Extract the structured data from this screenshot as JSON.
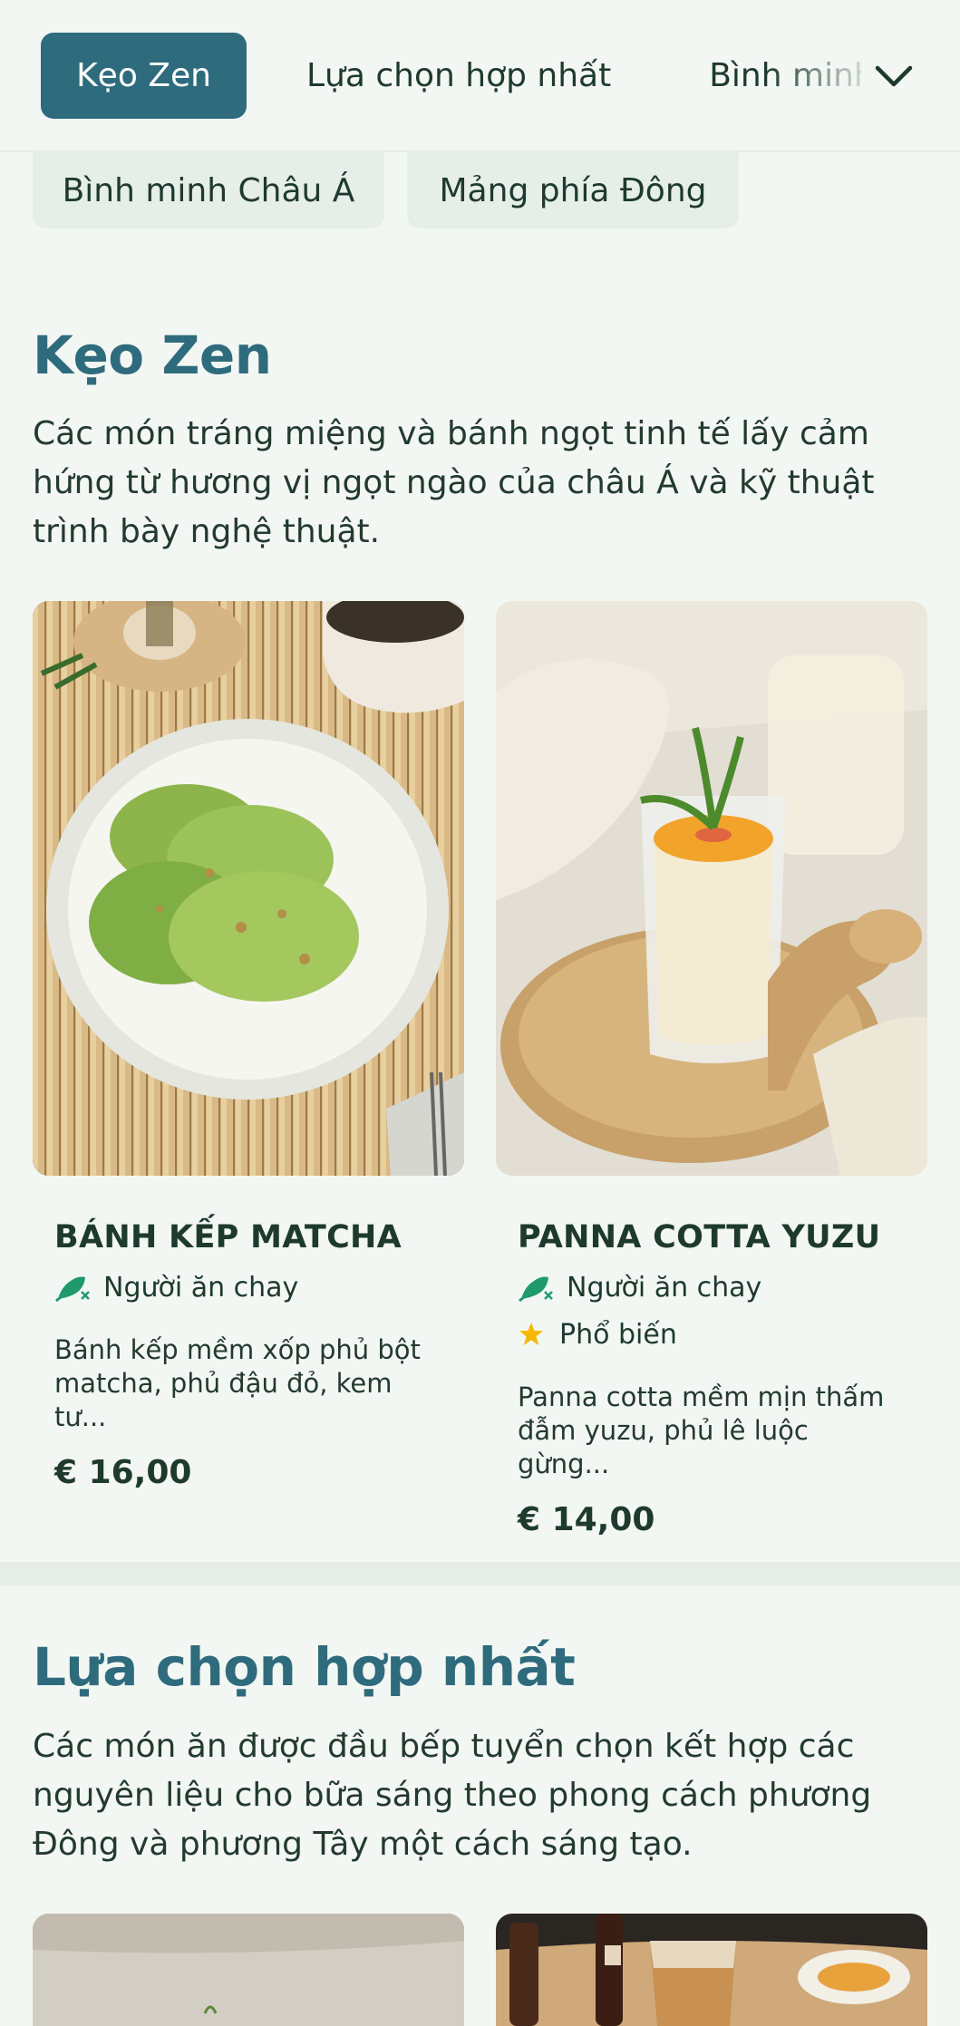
{
  "nav": {
    "tabs": [
      {
        "label": "Kẹo Zen",
        "active": true
      },
      {
        "label": "Lựa chọn hợp nhất",
        "active": false
      },
      {
        "label": "Bình minh",
        "active": false
      }
    ],
    "more_icon": "chevron-down-icon"
  },
  "chips": [
    "Bình minh Châu Á",
    "Mảng phía Đông"
  ],
  "sections": [
    {
      "title": "Kẹo Zen",
      "description": "Các món tráng miệng và bánh ngọt tinh tế lấy cảm hứng từ hương vị ngọt ngào của châu Á và kỹ thuật trình bày nghệ thuật.",
      "items": [
        {
          "name": "BÁNH KẾP MATCHA",
          "tags": [
            {
              "icon": "vegetarian-icon",
              "label": "Người ăn chay"
            }
          ],
          "description": "Bánh kếp mềm xốp phủ bột matcha, phủ đậu đỏ, kem tư...",
          "price": "€ 16,00"
        },
        {
          "name": "PANNA COTTA YUZU",
          "tags": [
            {
              "icon": "vegetarian-icon",
              "label": "Người ăn chay"
            },
            {
              "icon": "star-icon",
              "label": "Phổ biến"
            }
          ],
          "description": "Panna cotta mềm mịn thấm đẫm yuzu, phủ lê luộc gừng...",
          "price": "€ 14,00"
        }
      ]
    },
    {
      "title": "Lựa chọn hợp nhất",
      "description": "Các món ăn được đầu bếp tuyển chọn kết hợp các nguyên liệu cho bữa sáng theo phong cách phương Đông và phương Tây một cách sáng tạo."
    }
  ],
  "colors": {
    "accent": "#2e6b7d",
    "background": "#f3f7f3",
    "vegetarian": "#1f9a6c",
    "star": "#f5b800"
  }
}
